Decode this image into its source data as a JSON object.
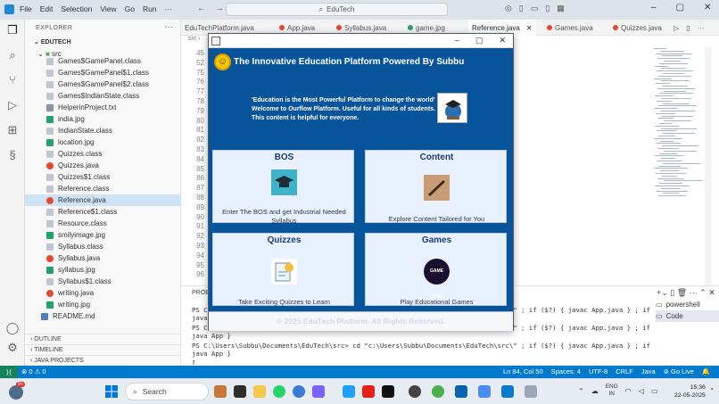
{
  "vscode": {
    "menu": [
      "File",
      "Edit",
      "Selection",
      "View",
      "Go",
      "Run",
      "···"
    ],
    "search_text": "EduTech",
    "explorer": {
      "header": "EXPLORER",
      "root": "EDUTECH",
      "src_folder": "src",
      "files": [
        {
          "name": "Games$GamePanel.class",
          "type": "class"
        },
        {
          "name": "Games$GamePanel$1.class",
          "type": "class"
        },
        {
          "name": "Games$GamePanel$2.class",
          "type": "class"
        },
        {
          "name": "Games$IndianState.class",
          "type": "class"
        },
        {
          "name": "HelperinProject.txt",
          "type": "txt"
        },
        {
          "name": "india.jpg",
          "type": "jpg"
        },
        {
          "name": "IndianState.class",
          "type": "class"
        },
        {
          "name": "location.jpg",
          "type": "jpg"
        },
        {
          "name": "Quizzes.class",
          "type": "class"
        },
        {
          "name": "Quizzes.java",
          "type": "java"
        },
        {
          "name": "Quizzes$1.class",
          "type": "class"
        },
        {
          "name": "Reference.class",
          "type": "class"
        },
        {
          "name": "Reference.java",
          "type": "java"
        },
        {
          "name": "Reference$1.class",
          "type": "class"
        },
        {
          "name": "Resource.class",
          "type": "class"
        },
        {
          "name": "smilyimage.jpg",
          "type": "jpg"
        },
        {
          "name": "Syllabus.class",
          "type": "class"
        },
        {
          "name": "Syllabus.java",
          "type": "java"
        },
        {
          "name": "syllabus.jpg",
          "type": "jpg"
        },
        {
          "name": "Syllabus$1.class",
          "type": "class"
        },
        {
          "name": "writing.java",
          "type": "java"
        },
        {
          "name": "writing.jpg",
          "type": "jpg"
        },
        {
          "name": "README.md",
          "type": "md"
        }
      ],
      "sections": [
        "OUTLINE",
        "TIMELINE",
        "JAVA PROJECTS"
      ]
    },
    "tabs": [
      "EduTechPlatform.java",
      "App.java",
      "Syllabus.java",
      "game.jpg",
      "Reference.java",
      "Games.java",
      "Quizzes.java"
    ],
    "breadcrumb": "src",
    "line_numbers": [
      "45",
      "52",
      "75",
      "76",
      "77",
      "78",
      "79",
      "80",
      "81",
      "82",
      "83",
      "84",
      "85",
      "86",
      "87",
      "88",
      "89",
      "90",
      "91",
      "92",
      "93",
      "94",
      "95",
      "96"
    ],
    "panel": {
      "tab_label": "PROB",
      "lines": [
        "PS C:\\Users\\Subbu\\Documents\\EduTech\\src> cd \"c:\\Users\\Subbu\\Documents\\EduTech\\src\\\" ; if ($?) { javac App.java } ; if ($?) {",
        "java App }",
        "PS C:\\Users\\Subbu\\Documents\\EduTech\\src> cd \"c:\\Users\\Subbu\\Documents\\EduTech\\src\\\" ; if ($?) { javac App.java } ; if ($?) {",
        "java App }",
        "PS C:\\Users\\Subbu\\Documents\\EduTech\\src> cd \"c:\\Users\\Subbu\\Documents\\EduTech\\src\\\" ; if ($?) { javac App.java } ; if ($?) {",
        "java App }"
      ],
      "terminals": [
        "powershell",
        "Code"
      ]
    },
    "status": {
      "left": "⊗ 0 ⚠ 0",
      "items": [
        "Ln 84, Col 50",
        "Spaces: 4",
        "UTF-8",
        "CRLF",
        "Java",
        "Go Live"
      ]
    }
  },
  "app_window": {
    "header": "The Innovative Education Platform Powered By Subbu",
    "quote": [
      "'Education is the Most Powerful Platform to change the world'",
      "Welcome to Ourflow Platform. Useful for all kinds of students.",
      "This content is helpful for everyone."
    ],
    "cards": [
      {
        "title": "BOS",
        "description": "Enter The BOS and get Industrial Needed Syllabus"
      },
      {
        "title": "Content",
        "description": "Explore Content Tailored for You"
      },
      {
        "title": "Quizzes",
        "description": "Take Exciting Quizzes to Learn"
      },
      {
        "title": "Games",
        "description": "Play Educational Games",
        "icon_text": "GAME ZONE"
      }
    ],
    "footer": "© 2025 EduTech Platform. All Rights Reserved."
  },
  "taskbar": {
    "search": "Search",
    "lang": [
      "ENG",
      "IN"
    ],
    "time": "15:36",
    "date": "22-05-2025",
    "badge": "9+"
  },
  "colors": {
    "statusbar": "#007acc",
    "app_bg": "#08549a",
    "card_bg": "#e8f1fd"
  }
}
